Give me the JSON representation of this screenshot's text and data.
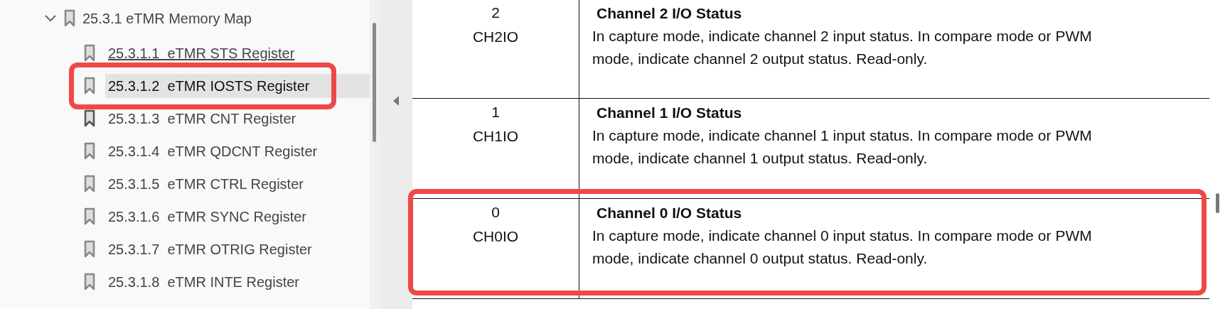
{
  "bookmarks": {
    "label": "25.3.1 eTMR Memory Map",
    "expanded": true,
    "children": [
      {
        "label": "25.3.1.1  eTMR STS Register",
        "selected": false,
        "underlined": true,
        "highlighted": false
      },
      {
        "label": "25.3.1.2  eTMR IOSTS Register",
        "selected": true,
        "underlined": false,
        "highlighted": true
      },
      {
        "label": "25.3.1.3  eTMR CNT Register",
        "selected": false,
        "underlined": false,
        "highlighted": false
      },
      {
        "label": "25.3.1.4  eTMR QDCNT Register",
        "selected": false,
        "underlined": false,
        "highlighted": false
      },
      {
        "label": "25.3.1.5  eTMR CTRL Register",
        "selected": false,
        "underlined": false,
        "highlighted": false
      },
      {
        "label": "25.3.1.6  eTMR SYNC Register",
        "selected": false,
        "underlined": false,
        "highlighted": false
      },
      {
        "label": "25.3.1.7  eTMR OTRIG Register",
        "selected": false,
        "underlined": false,
        "highlighted": false
      },
      {
        "label": "25.3.1.8  eTMR INTE Register",
        "selected": false,
        "underlined": false,
        "highlighted": false
      }
    ]
  },
  "table": {
    "rows": [
      {
        "bit": "2",
        "field": "CH2IO",
        "title": "Channel 2 I/O Status",
        "description": "In capture mode, indicate channel 2 input status. In compare mode or PWM mode, indicate channel 2 output status. Read-only.",
        "highlighted": false
      },
      {
        "bit": "1",
        "field": "CH1IO",
        "title": "Channel 1 I/O Status",
        "description": "In capture mode, indicate channel 1 input status. In compare mode or PWM mode, indicate channel 1 output status. Read-only.",
        "highlighted": false
      },
      {
        "bit": "0",
        "field": "CH0IO",
        "title": "Channel 0 I/O Status",
        "description": "In capture mode, indicate channel 0 input status. In compare mode or PWM mode, indicate channel 0 output status. Read-only.",
        "highlighted": true
      }
    ]
  }
}
